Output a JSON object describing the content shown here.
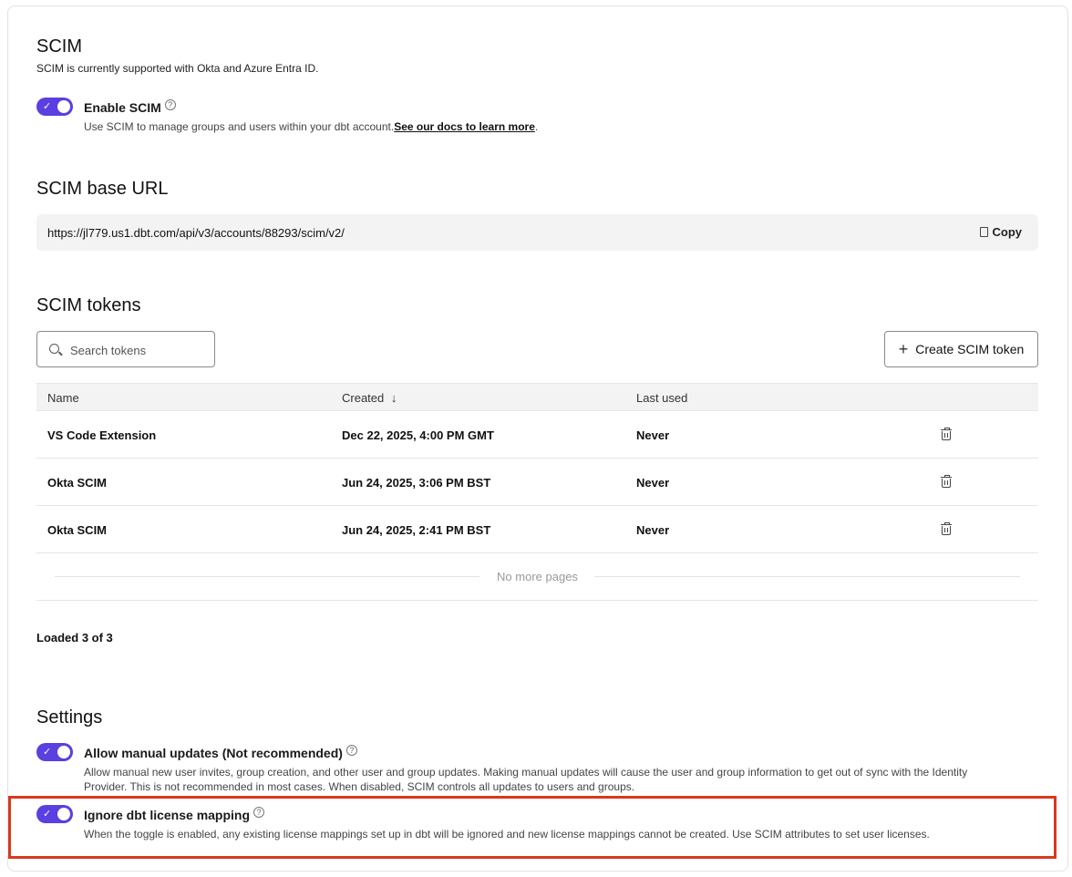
{
  "scim": {
    "title": "SCIM",
    "subtitle": "SCIM is currently supported with Okta and Azure Entra ID.",
    "enable": {
      "label": "Enable SCIM",
      "enabled": true,
      "description": "Use SCIM to manage groups and users within your dbt account.",
      "link_text": "See our docs to learn more",
      "trailing": "."
    }
  },
  "base_url": {
    "title": "SCIM base URL",
    "url": "https://jl779.us1.dbt.com/api/v3/accounts/88293/scim/v2/",
    "copy_label": "Copy"
  },
  "tokens": {
    "title": "SCIM tokens",
    "search_placeholder": "Search tokens",
    "create_label": "Create SCIM token",
    "columns": {
      "name": "Name",
      "created": "Created",
      "created_sort": "↓",
      "last_used": "Last used"
    },
    "rows": [
      {
        "name": "VS Code Extension",
        "created": "Dec 22, 2025, 4:00 PM GMT",
        "last_used": "Never"
      },
      {
        "name": "Okta SCIM",
        "created": "Jun 24, 2025, 3:06 PM BST",
        "last_used": "Never"
      },
      {
        "name": "Okta SCIM",
        "created": "Jun 24, 2025, 2:41 PM BST",
        "last_used": "Never"
      }
    ],
    "no_more_pages": "No more pages",
    "loaded": "Loaded 3 of 3"
  },
  "settings": {
    "title": "Settings",
    "manual_updates": {
      "label": "Allow manual updates (Not recommended)",
      "enabled": true,
      "description_line1": "Allow manual new user invites, group creation, and other user and group updates. Making manual updates will cause the user and group information to get out of sync with the Identity",
      "description_line2": "Provider. This is not recommended in most cases. When disabled, SCIM controls all updates to users and groups."
    },
    "ignore_license": {
      "label": "Ignore dbt license mapping",
      "enabled": true,
      "description": "When the toggle is enabled, any existing license mappings set up in dbt will be ignored and new license mappings cannot be created. Use SCIM attributes to set user licenses."
    }
  },
  "colors": {
    "accent": "#5b3fe0",
    "highlight": "#d9381e"
  }
}
